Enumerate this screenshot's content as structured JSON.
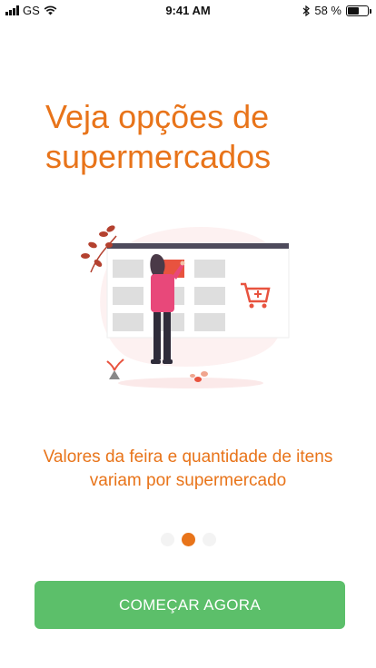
{
  "status_bar": {
    "carrier": "GS",
    "time": "9:41 AM",
    "battery_percent": "58 %",
    "battery_level": 0.58
  },
  "onboarding": {
    "title": "Veja opções de\nsupermercados",
    "subtitle": "Valores da feira e quantidade de itens\nvariam por supermercado",
    "page_index": 1,
    "page_count": 3,
    "cta_label": "COMEÇAR AGORA"
  },
  "colors": {
    "accent": "#e8741a",
    "cta": "#5cbf6a",
    "illustration_primary": "#e8533f"
  },
  "icons": {
    "signal": "cellular-signal-icon",
    "wifi": "wifi-icon",
    "bluetooth": "bluetooth-icon",
    "battery": "battery-icon",
    "cart": "shopping-cart-icon"
  }
}
